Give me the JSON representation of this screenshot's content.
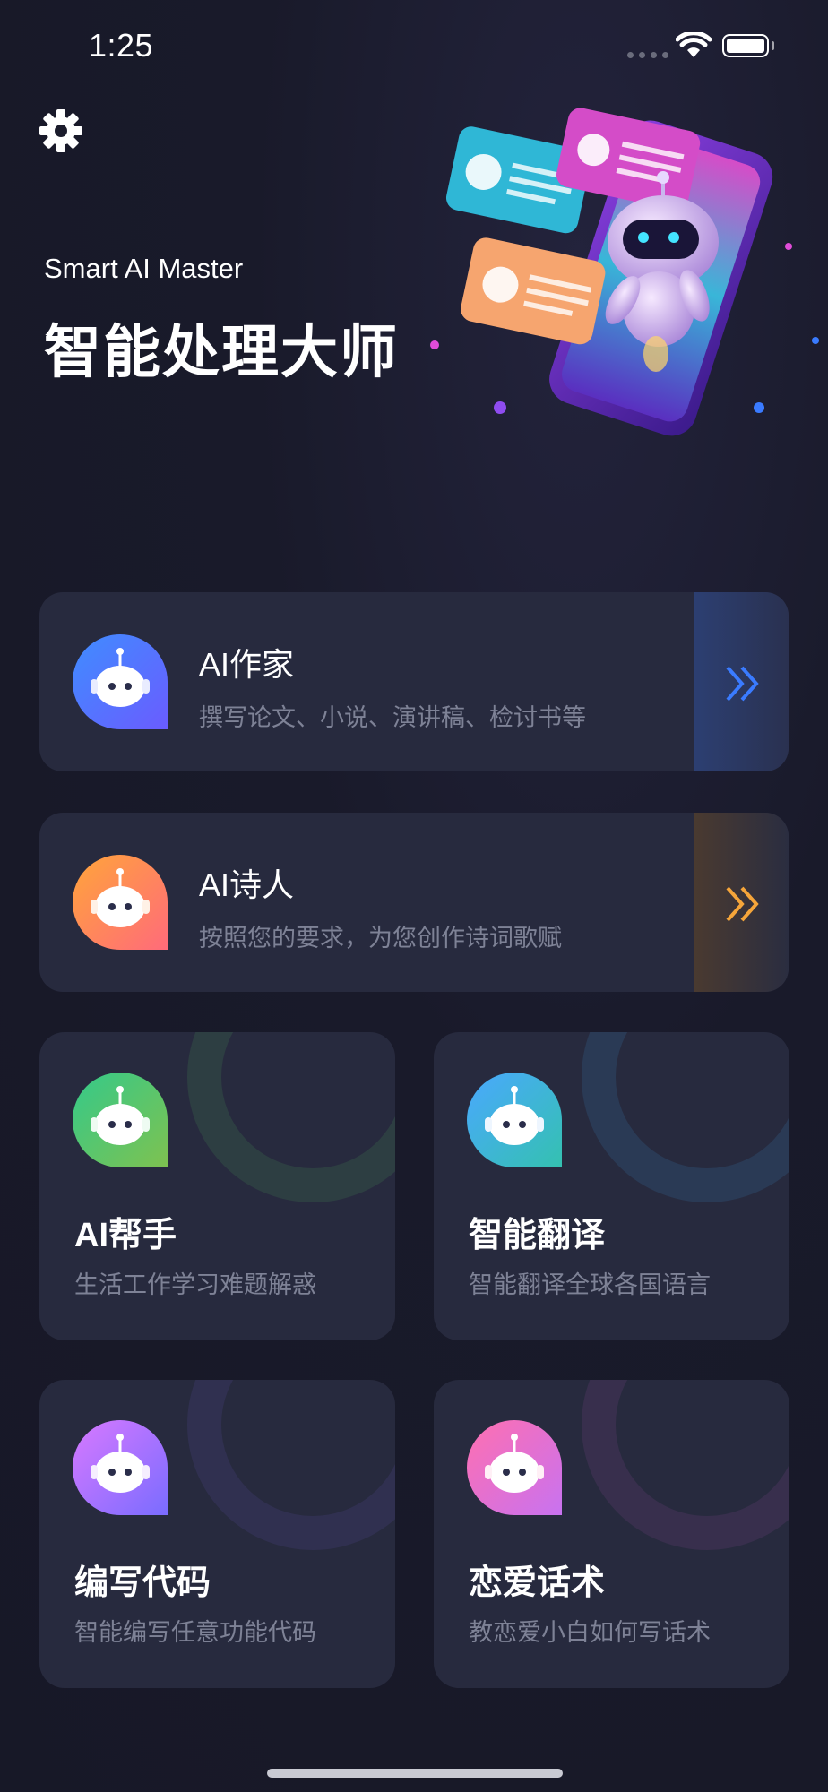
{
  "status_bar": {
    "time": "1:25"
  },
  "header": {
    "settings_icon": "gear-icon",
    "subtitle": "Smart AI Master",
    "title": "智能处理大师"
  },
  "wide_cards": [
    {
      "title": "AI作家",
      "desc": "撰写论文、小说、演讲稿、检讨书等",
      "icon": "robot-icon",
      "accent": "#3a7bff"
    },
    {
      "title": "AI诗人",
      "desc": "按照您的要求，为您创作诗词歌赋",
      "icon": "robot-icon",
      "accent": "#f5a53a"
    }
  ],
  "grid_cards": [
    {
      "title": "AI帮手",
      "desc": "生活工作学习难题解惑",
      "icon": "robot-icon",
      "accent": "#3fc27a"
    },
    {
      "title": "智能翻译",
      "desc": "智能翻译全球各国语言",
      "icon": "robot-icon",
      "accent": "#3aa0ee"
    },
    {
      "title": "编写代码",
      "desc": "智能编写任意功能代码",
      "icon": "robot-icon",
      "accent": "#b36bf0"
    },
    {
      "title": "恋爱话术",
      "desc": "教恋爱小白如何写话术",
      "icon": "robot-icon",
      "accent": "#f06aa8"
    }
  ]
}
